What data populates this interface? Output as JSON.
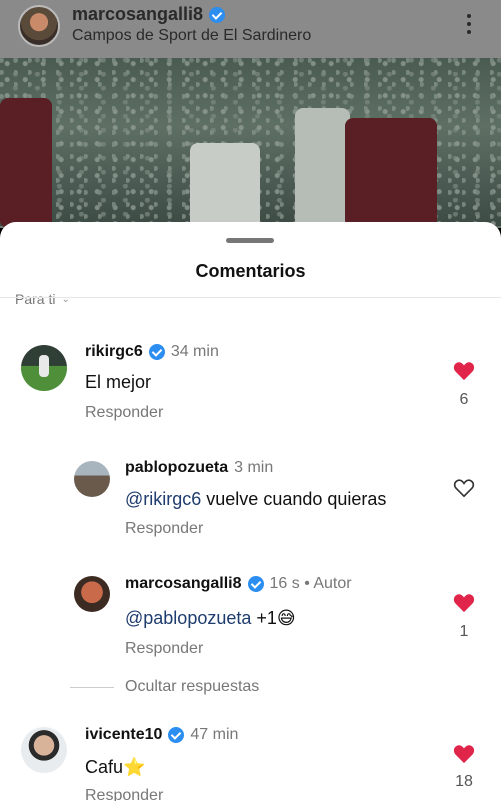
{
  "post": {
    "username": "marcosangalli8",
    "location": "Campos de Sport de El Sardinero"
  },
  "sheet": {
    "title": "Comentarios",
    "filter_label": "Para ti"
  },
  "comments": [
    {
      "username": "rikirgc6",
      "time": "34 min",
      "text": "El mejor",
      "reply_label": "Responder",
      "likes": "6",
      "liked": true,
      "verified": true
    },
    {
      "username": "pablopozueta",
      "time": "3 min",
      "mention": "@rikirgc6",
      "text": " vuelve cuando quieras",
      "reply_label": "Responder",
      "liked": false,
      "verified": false
    },
    {
      "username": "marcosangalli8",
      "time": "16 s",
      "author_tag": "Autor",
      "mention": "@pablopozueta",
      "text": " +1😅",
      "reply_label": "Responder",
      "likes": "1",
      "liked": true,
      "verified": true
    },
    {
      "username": "ivicente10",
      "time": "47 min",
      "text": "Cafu⭐",
      "reply_label": "Responder",
      "likes": "18",
      "liked": true,
      "verified": true
    }
  ],
  "hide_replies_label": "Ocultar respuestas",
  "colors": {
    "heart_red": "#e0244a",
    "verified_blue": "#2b8ef0",
    "mention_blue": "#1f3c6e"
  },
  "icons": [
    "more-vertical-icon",
    "verified-badge-icon",
    "heart-filled-icon",
    "heart-outline-icon",
    "chevron-down-icon"
  ]
}
